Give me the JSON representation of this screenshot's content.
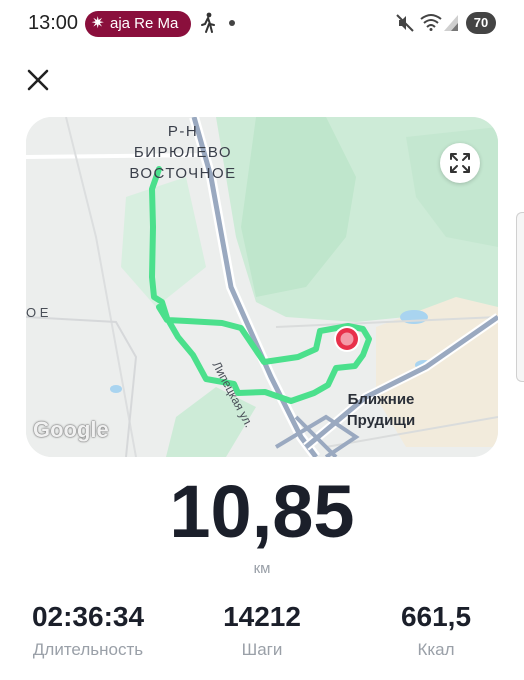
{
  "status_bar": {
    "time": "13:00",
    "media_text": "aja Re Ma",
    "battery": "70",
    "icons": [
      "spark-icon",
      "walking-icon",
      "notification-dot-icon",
      "mute-icon",
      "wifi-icon",
      "signal-icon",
      "battery-icon"
    ]
  },
  "header": {
    "close_icon": "close-icon"
  },
  "map": {
    "district_label": "Р-Н БИРЮЛЕВО ВОСТОЧНОЕ",
    "street_label": "Липецкая ул.",
    "town_label": "Ближние Прудищи",
    "edge_label": "О Е",
    "google_logo": "Google",
    "expand_icon": "expand-icon",
    "route_color": "#4be08c",
    "end_marker_color": "#e8304a"
  },
  "workout": {
    "distance": "10,85",
    "distance_unit": "км"
  },
  "stats": [
    {
      "value": "02:36:34",
      "label": "Длительность"
    },
    {
      "value": "14212",
      "label": "Шаги"
    },
    {
      "value": "661,5",
      "label": "Ккал"
    }
  ]
}
